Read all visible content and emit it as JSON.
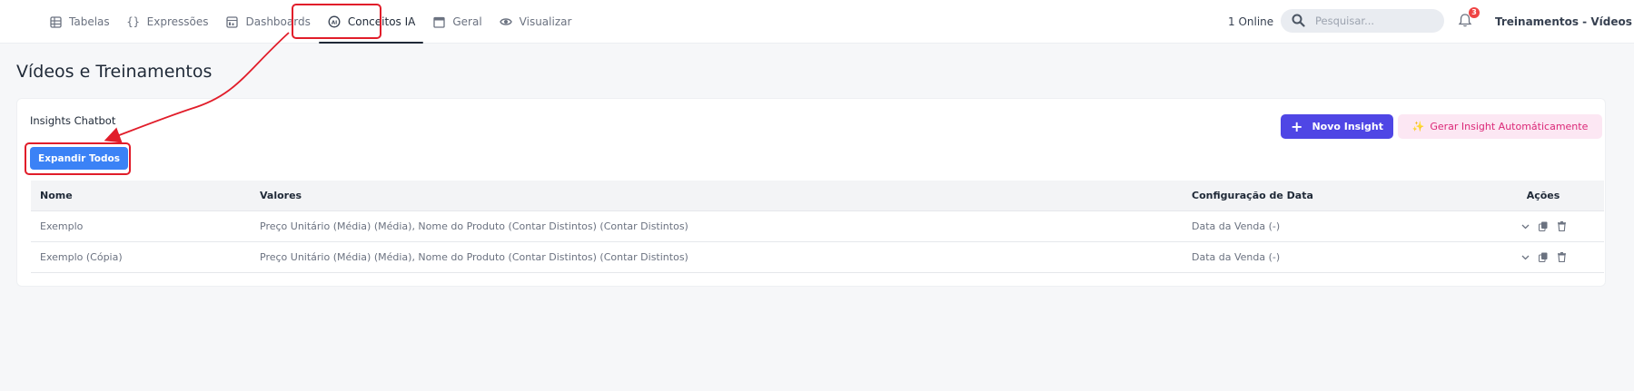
{
  "nav": {
    "items": [
      {
        "label": "Tabelas",
        "icon": "table-icon",
        "active": false
      },
      {
        "label": "Expressões",
        "icon": "braces-icon",
        "active": false
      },
      {
        "label": "Dashboards",
        "icon": "dashboard-icon",
        "active": false
      },
      {
        "label": "Conceitos IA",
        "icon": "ai-icon",
        "active": true
      },
      {
        "label": "Geral",
        "icon": "calendar-icon",
        "active": false
      },
      {
        "label": "Visualizar",
        "icon": "eye-icon",
        "active": false
      }
    ]
  },
  "header": {
    "online": "1 Online",
    "search_placeholder": "Pesquisar...",
    "notification_count": "3",
    "workspace": "Treinamentos - Vídeos"
  },
  "page": {
    "title": "Vídeos e Treinamentos"
  },
  "card": {
    "title": "Insights Chatbot",
    "expand_label": "Expandir Todos",
    "new_label": "Novo Insight",
    "auto_label": "Gerar Insight Automáticamente"
  },
  "table": {
    "headers": {
      "name": "Nome",
      "values": "Valores",
      "date_config": "Configuração de Data",
      "actions": "Ações"
    },
    "rows": [
      {
        "name": "Exemplo",
        "values": "Preço Unitário (Média) (Média), Nome do Produto (Contar Distintos) (Contar Distintos)",
        "date_config": "Data da Venda (-)"
      },
      {
        "name": "Exemplo (Cópia)",
        "values": "Preço Unitário (Média) (Média), Nome do Produto (Contar Distintos) (Contar Distintos)",
        "date_config": "Data da Venda (-)"
      }
    ]
  },
  "colors": {
    "accent": "#4f46e5",
    "expand": "#3b82f6",
    "auto_bg": "#fce7f3",
    "auto_text": "#db2777",
    "annotation": "#e11d2a"
  }
}
